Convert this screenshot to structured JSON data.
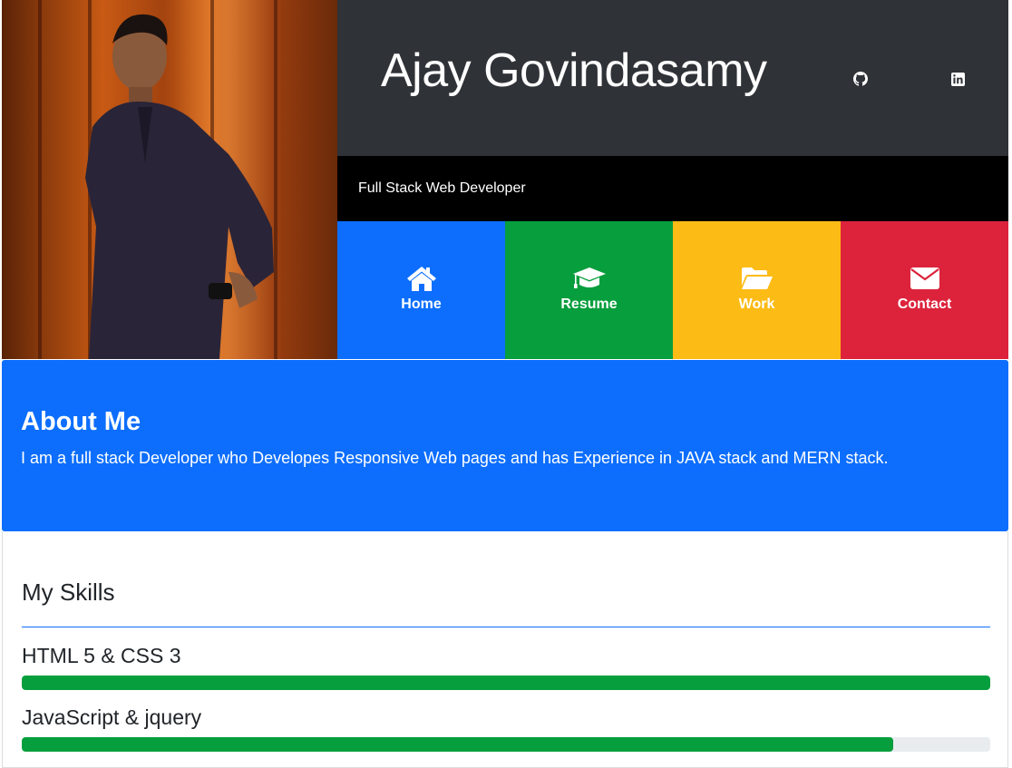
{
  "profile": {
    "name": "Ajay Govindasamy",
    "tagline": "Full Stack Web Developer",
    "social": [
      {
        "icon": "github-icon"
      },
      {
        "icon": "linkedin-icon"
      }
    ]
  },
  "nav": {
    "items": [
      {
        "label": "Home",
        "icon": "home-icon",
        "color": "#0d6efd"
      },
      {
        "label": "Resume",
        "icon": "graduation-cap-icon",
        "color": "#079e3d"
      },
      {
        "label": "Work",
        "icon": "folder-open-icon",
        "color": "#fdbb16"
      },
      {
        "label": "Contact",
        "icon": "envelope-icon",
        "color": "#dc233b"
      }
    ]
  },
  "about": {
    "heading": "About Me",
    "text": "I am a full stack Developer who Developes Responsive Web pages and has Experience in JAVA stack and MERN stack."
  },
  "skills": {
    "heading": "My Skills",
    "items": [
      {
        "name": "HTML 5 & CSS 3",
        "level": 1.0
      },
      {
        "name": "JavaScript & jquery",
        "level": 0.9
      }
    ]
  },
  "colors": {
    "header_dark": "#2f3237",
    "accent_blue": "#0d6efd",
    "skill_bar": "#079e3d"
  }
}
